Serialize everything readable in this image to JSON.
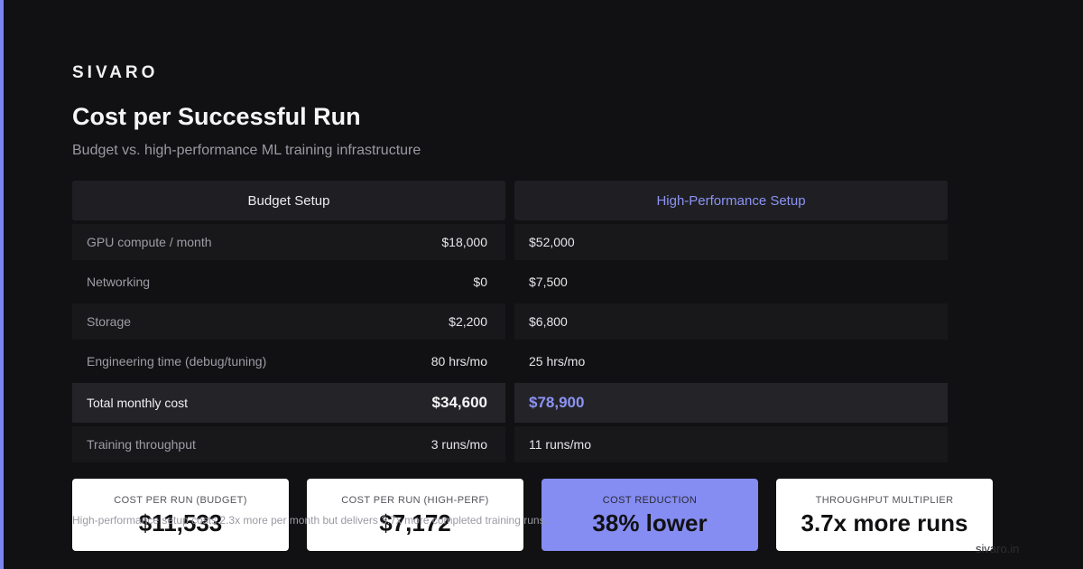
{
  "brand": {
    "logo": "SIVARO",
    "domain": "sivaro.in"
  },
  "header": {
    "title": "Cost per Successful Run",
    "subtitle": "Budget vs. high-performance ML training infrastructure"
  },
  "columns": {
    "budget": {
      "heading": "Budget Setup",
      "rows": [
        {
          "label": "GPU compute / month",
          "value": "$18,000"
        },
        {
          "label": "Networking",
          "value": "$0"
        },
        {
          "label": "Storage",
          "value": "$2,200"
        },
        {
          "label": "Engineering time (debug/tuning)",
          "value": "80 hrs/mo"
        },
        {
          "label": "Total monthly cost",
          "value": "$34,600"
        },
        {
          "label": "Training throughput",
          "value": "3 runs/mo"
        }
      ]
    },
    "high_perf": {
      "heading": "High-Performance Setup",
      "rows": [
        {
          "value": "$52,000"
        },
        {
          "value": "$7,500"
        },
        {
          "value": "$6,800"
        },
        {
          "value": "25 hrs/mo"
        },
        {
          "value": "$78,900"
        },
        {
          "value": "11 runs/mo"
        }
      ]
    }
  },
  "cards": [
    {
      "label": "COST PER RUN (BUDGET)",
      "value": "$11,533"
    },
    {
      "label": "COST PER RUN (HIGH-PERF)",
      "value": "$7,172"
    },
    {
      "label": "COST REDUCTION",
      "value": "38% lower"
    },
    {
      "label": "THROUGHPUT MULTIPLIER",
      "value": "3.7x more runs"
    }
  ],
  "footnote": "High-performance setup costs 2.3x more per month but delivers 3.7x more completed training runs.",
  "colors": {
    "accent": "#7b86f0",
    "highlight_card": "#858cf2",
    "background": "#111113"
  }
}
